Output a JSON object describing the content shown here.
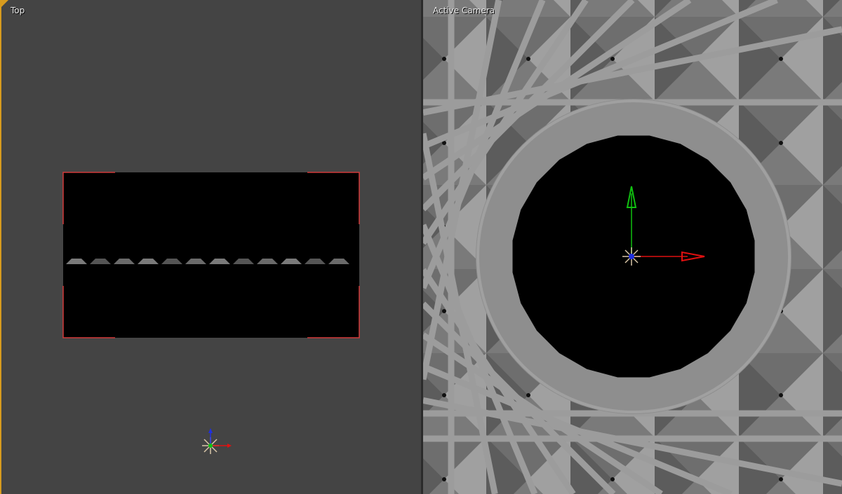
{
  "viewports": {
    "left": {
      "label": "Top"
    },
    "right": {
      "label": "Active Camera"
    }
  },
  "colors": {
    "active_border": "#d79b1e",
    "selection": "#d23a3a",
    "axis_x": "#e01010",
    "axis_y": "#10c010",
    "axis_z": "#2030e0"
  }
}
